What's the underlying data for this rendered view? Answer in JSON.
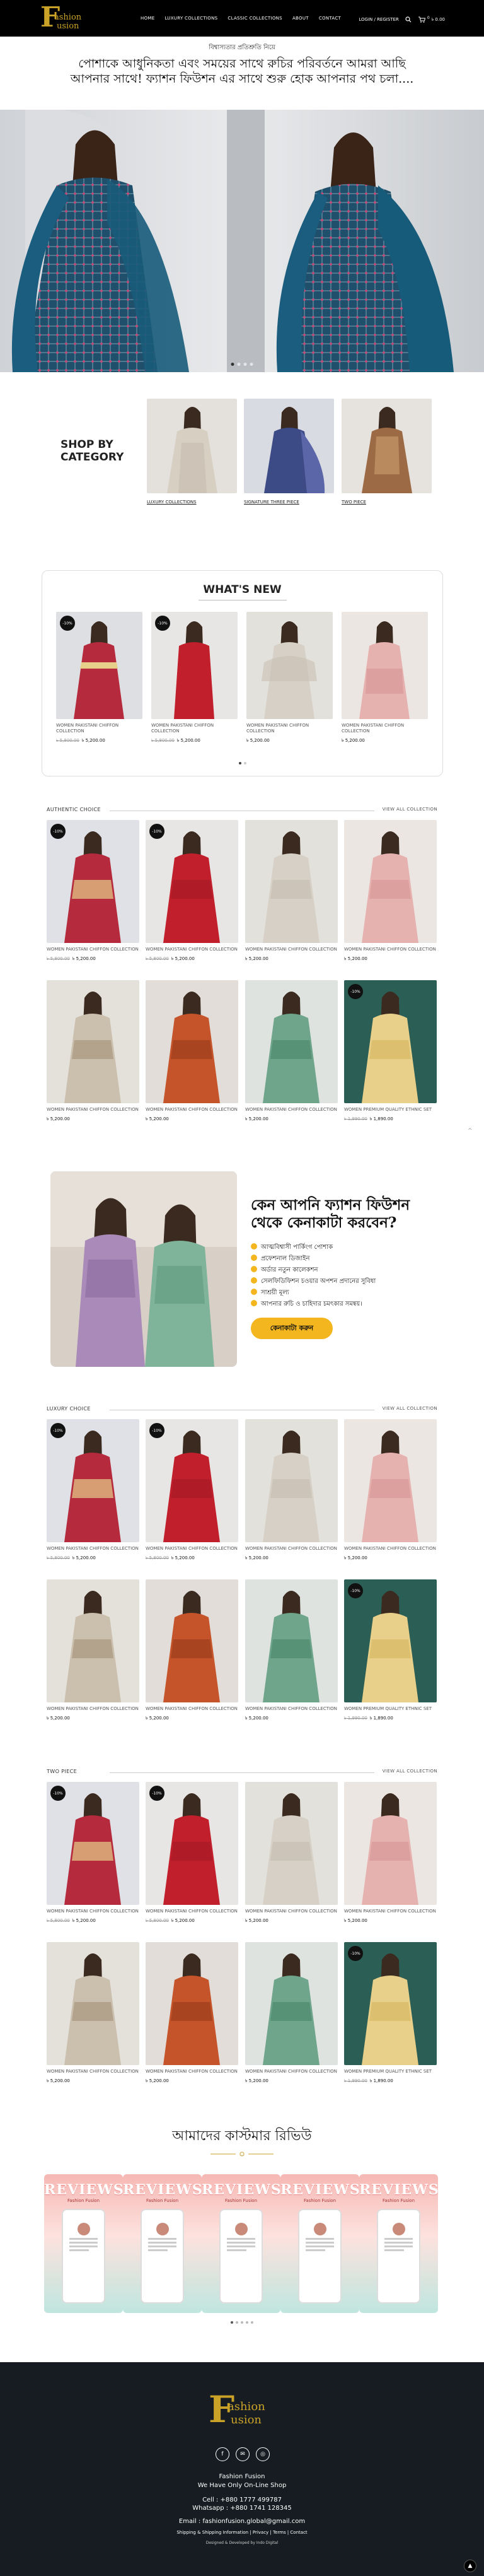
{
  "header": {
    "logo_letter": "F",
    "logo_line1": "ashion",
    "logo_line2": "usion",
    "nav": [
      "HOME",
      "LUXURY COLLECTIONS",
      "CLASSIC COLLECTIONS",
      "ABOUT",
      "CONTACT"
    ],
    "login": "LOGIN / REGISTER",
    "cart_count": "0",
    "cart_total": "৳ 0.00"
  },
  "hero": {
    "tagline": "বিশ্বাস্যতার প্রতিশ্রুতি নিয়ে",
    "headline": "পোশাকে আধুনিকতা এবং সময়ের সাথে রুচির পরিবর্তনে আমরা আছি আপনার সাথে! ফ্যাশন ফিউশন এর সাথে শুরু হোক আপনার পথ চলা....",
    "slide_count": 4,
    "active_slide": 0
  },
  "shop_by_category": {
    "title": "SHOP BY CATEGORY",
    "categories": [
      "LUXURY COLLECTIONS",
      "SIGNATURE THREE PIECE",
      "TWO PIECE"
    ]
  },
  "whats_new": {
    "title": "WHAT'S NEW",
    "products": [
      {
        "badge": "-10%",
        "name": "WOMEN PAKISTANI CHIFFON COLLECTION",
        "old": "৳ 5,800.00",
        "price": "৳ 5,200.00"
      },
      {
        "badge": "-10%",
        "name": "WOMEN PAKISTANI CHIFFON COLLECTION",
        "old": "৳ 5,800.00",
        "price": "৳ 5,200.00"
      },
      {
        "badge": "",
        "name": "WOMEN PAKISTANI CHIFFON COLLECTION",
        "old": "",
        "price": "৳ 5,200.00"
      },
      {
        "badge": "",
        "name": "WOMEN PAKISTANI CHIFFON COLLECTION",
        "old": "",
        "price": "৳ 5,200.00"
      }
    ]
  },
  "grid_products": [
    {
      "badge": "-10%",
      "name": "WOMEN PAKISTANI CHIFFON COLLECTION",
      "old": "৳ 5,800.00",
      "price": "৳ 5,200.00"
    },
    {
      "badge": "-10%",
      "name": "WOMEN PAKISTANI CHIFFON COLLECTION",
      "old": "৳ 5,800.00",
      "price": "৳ 5,200.00"
    },
    {
      "badge": "",
      "name": "WOMEN PAKISTANI CHIFFON COLLECTION",
      "old": "",
      "price": "৳ 5,200.00"
    },
    {
      "badge": "",
      "name": "WOMEN PAKISTANI CHIFFON COLLECTION",
      "old": "",
      "price": "৳ 5,200.00"
    },
    {
      "badge": "",
      "name": "WOMEN PAKISTANI CHIFFON COLLECTION",
      "old": "",
      "price": "৳ 5,200.00"
    },
    {
      "badge": "",
      "name": "WOMEN PAKISTANI CHIFFON COLLECTION",
      "old": "",
      "price": "৳ 5,200.00"
    },
    {
      "badge": "",
      "name": "WOMEN PAKISTANI CHIFFON COLLECTION",
      "old": "",
      "price": "৳ 5,200.00"
    },
    {
      "badge": "-10%",
      "name": "WOMEN PREMIUM QUALITY ETHNIC SET",
      "old": "৳ 1,990.00",
      "price": "৳ 1,890.00"
    }
  ],
  "sections": [
    {
      "title": "AUTHENTIC CHOICE",
      "view_all": "VIEW ALL COLLECTION"
    },
    {
      "title": "LUXURY CHOICE",
      "view_all": "VIEW ALL COLLECTION"
    },
    {
      "title": "TWO PIECE",
      "view_all": "VIEW ALL COLLECTION"
    }
  ],
  "why": {
    "title": "কেন আপনি ফ্যাশন ফিউশন থেকে কেনাকাটা করবেন?",
    "points": [
      "আত্মবিশ্বাসী পার্কিংগ পোশাক",
      "প্রফেশনাল ডিজাইন",
      "অর্ডার নতুন কালেকশন",
      "সেলফিডিফিশন চওয়ার অপশন প্রদানের সুবিধা",
      "সাশ্রয়ী মূল্য",
      "আপনার রুচি ও চাহিদার চমৎকার সমন্বয়।"
    ],
    "button": "কেনাকাটা করুন"
  },
  "reviews": {
    "title": "আমাদের কাস্টমার রিভিউ",
    "card_title": "REVIEWS",
    "card_sub": "Fashion Fusion",
    "count": 5,
    "dots": 5,
    "active_dot": 0
  },
  "footer": {
    "brand": "Fashion Fusion",
    "slogan": "We Have Only On-Line Shop",
    "cell": "Cell : +880 1777 499787",
    "whatsapp": "Whatsapp : +880 1741 128345",
    "email": "Email : fashionfusion.global@gmail.com",
    "links": "Shipping & Shipping Information | Privacy | Terms | Contact",
    "credit": "Designed & Developed by Indo Digital"
  },
  "colors": {
    "accent": "#f3b61f",
    "gold": "#c9a227",
    "footer_bg": "#161c21"
  }
}
